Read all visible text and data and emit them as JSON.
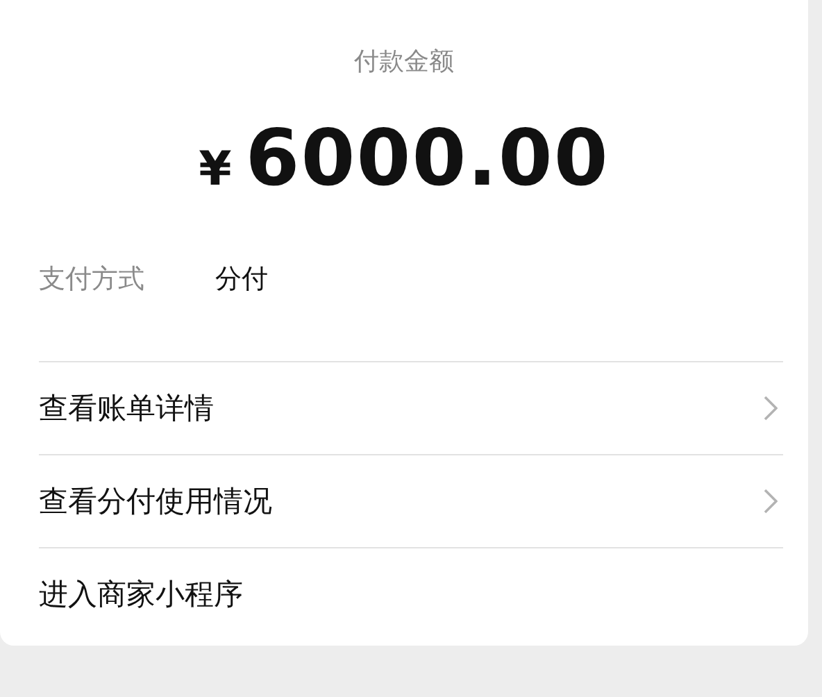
{
  "payment": {
    "title": "付款金额",
    "currency": "¥",
    "amount": "6000.00"
  },
  "method": {
    "label": "支付方式",
    "value": "分付"
  },
  "links": [
    {
      "label": "查看账单详情",
      "chevron": true
    },
    {
      "label": "查看分付使用情况",
      "chevron": true
    },
    {
      "label": "进入商家小程序",
      "chevron": false
    }
  ]
}
